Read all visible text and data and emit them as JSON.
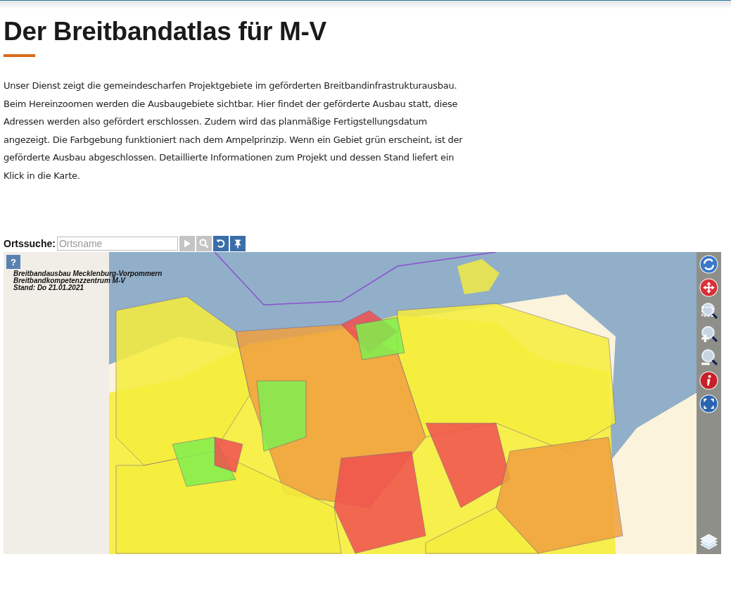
{
  "page": {
    "title": "Der Breitbandatlas für M-V",
    "intro": "Unser Dienst zeigt die gemeindescharfen Projektgebiete im geförderten Breitbandinfrastrukturausbau. Beim Hereinzoomen werden die Ausbaugebiete sichtbar. Hier findet der geförderte Ausbau statt, diese Adressen werden also gefördert erschlossen. Zudem wird das planmäßige Fertigstellungsdatum angezeigt. Die Farbgebung funktioniert nach dem Ampelprinzip. Wenn ein Gebiet grün erscheint, ist der geförderte Ausbau abgeschlossen. Detaillierte Informationen zum Projekt und dessen Stand liefert ein Klick in die Karte."
  },
  "search": {
    "label": "Ortssuche:",
    "placeholder": "Ortsname",
    "buttons": [
      {
        "kind": "go",
        "disabled": true
      },
      {
        "kind": "search",
        "disabled": true
      },
      {
        "kind": "reset",
        "disabled": false
      },
      {
        "kind": "pin",
        "disabled": false
      }
    ]
  },
  "map": {
    "help_button": "?",
    "legend_lines": [
      "Breitbandausbau Mecklenburg-Vorpommern",
      "Breitbandkompetenzzentrum M-V",
      "Stand: Do 21.01.2021"
    ],
    "tools": [
      {
        "kind": "refresh"
      },
      {
        "kind": "pan"
      },
      {
        "kind": "zoom-box"
      },
      {
        "kind": "zoom-in"
      },
      {
        "kind": "zoom-out"
      },
      {
        "kind": "info"
      },
      {
        "kind": "fullscreen"
      }
    ],
    "layers_button": true
  }
}
